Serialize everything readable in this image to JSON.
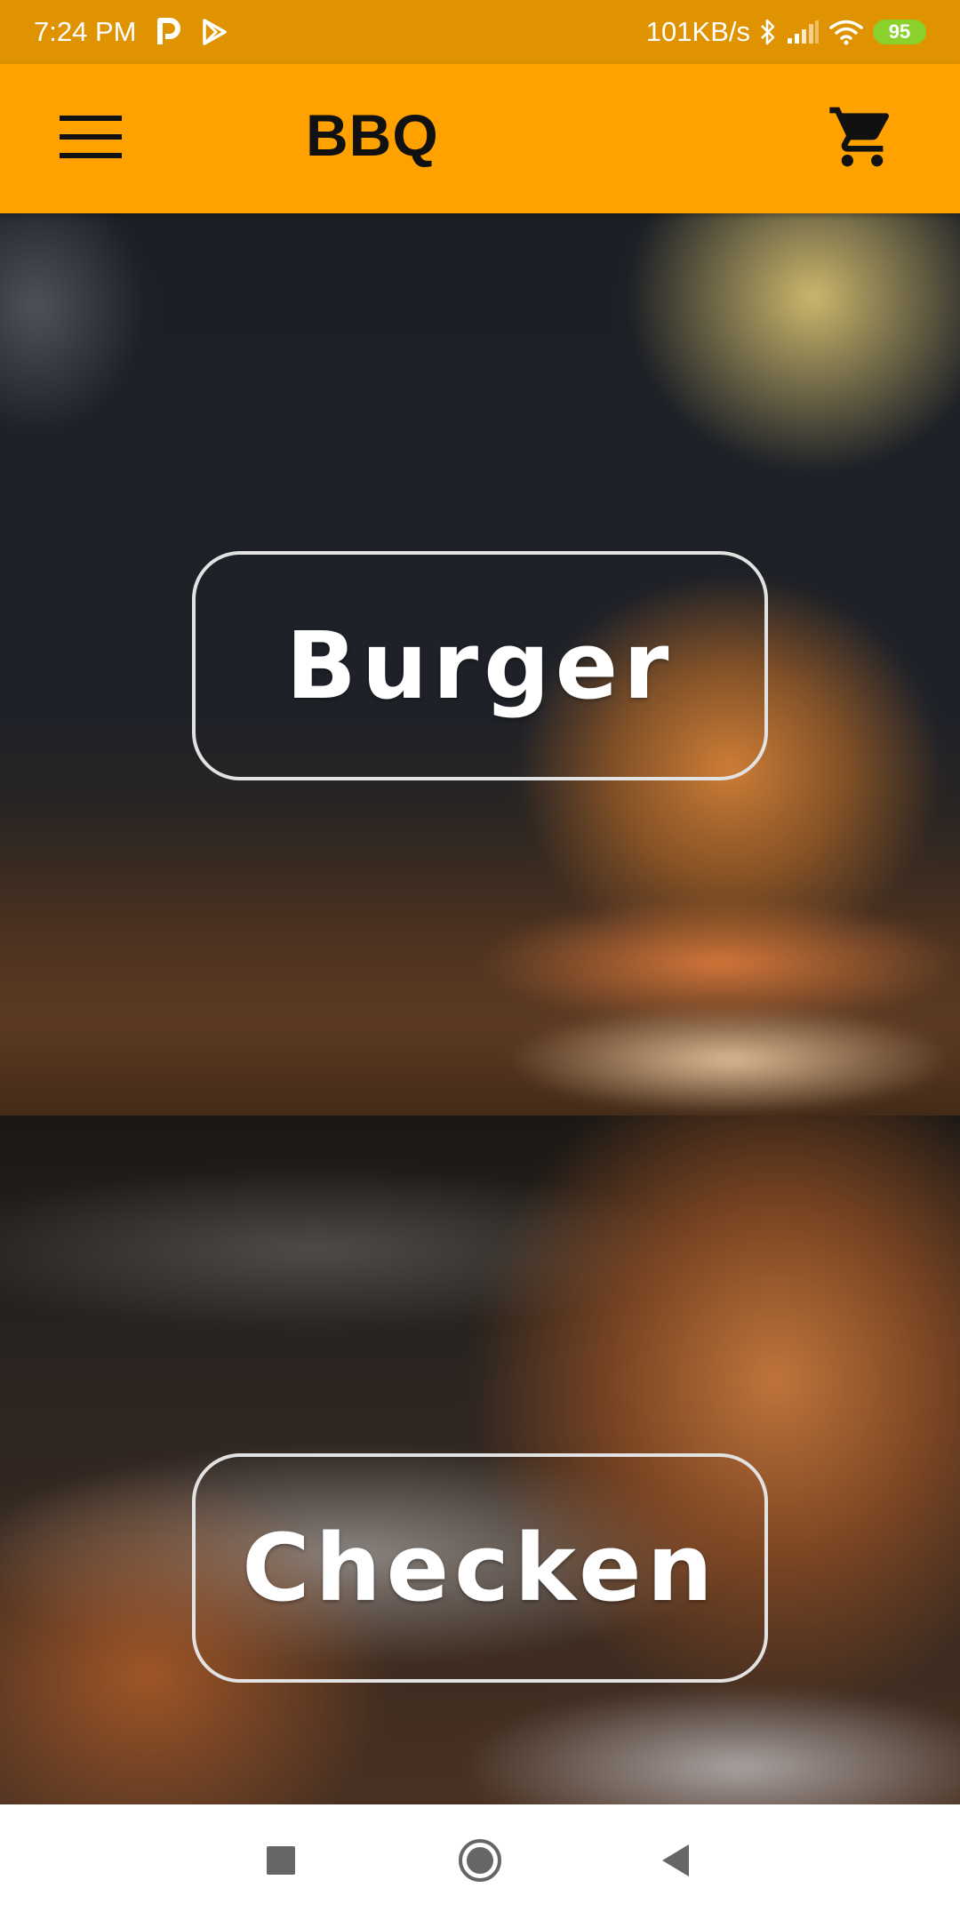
{
  "status_bar": {
    "time": "7:24 PM",
    "network_speed": "101KB/s",
    "battery_level": "95",
    "icons": [
      "p-app-icon",
      "play-store-icon",
      "bluetooth-icon",
      "signal-icon",
      "wifi-icon",
      "battery-icon"
    ]
  },
  "app_bar": {
    "title": "BBQ",
    "menu_icon": "menu-icon",
    "cart_icon": "cart-icon",
    "color": "#ffa200"
  },
  "categories": [
    {
      "label": "Burger"
    },
    {
      "label": "Checken"
    }
  ],
  "nav_bar": {
    "buttons": [
      "recents-icon",
      "home-icon",
      "back-icon"
    ]
  },
  "colors": {
    "status_bar": "#e09300",
    "app_bar": "#ffa200",
    "card_text": "#ffffff",
    "card_border": "#e2e2e2",
    "battery": "#8bd12b"
  }
}
